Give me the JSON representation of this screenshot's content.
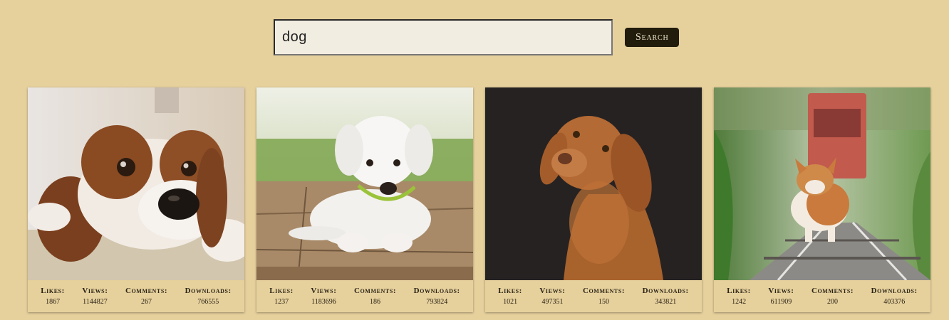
{
  "search": {
    "value": "dog",
    "button_label": "Search"
  },
  "stat_labels": {
    "likes": "Likes:",
    "views": "Views:",
    "comments": "Comments:",
    "downloads": "Downloads:"
  },
  "cards": [
    {
      "image": "spaniel-puppy-lying-on-rug",
      "likes": "1867",
      "views": "1144827",
      "comments": "267",
      "downloads": "766555"
    },
    {
      "image": "white-puppy-on-wooden-deck",
      "likes": "1237",
      "views": "1183696",
      "comments": "186",
      "downloads": "793824"
    },
    {
      "image": "vizsla-on-dark-background",
      "likes": "1021",
      "views": "497351",
      "comments": "150",
      "downloads": "343821"
    },
    {
      "image": "corgi-on-railway-tracks",
      "likes": "1242",
      "views": "611909",
      "comments": "200",
      "downloads": "403376"
    }
  ]
}
